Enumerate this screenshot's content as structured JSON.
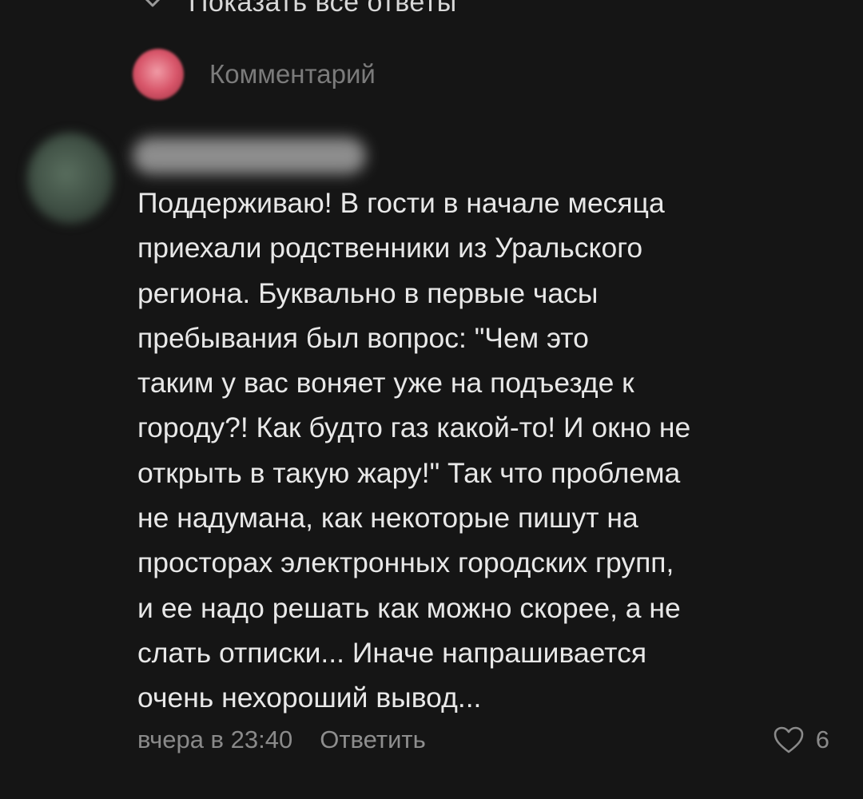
{
  "thread": {
    "show_replies_label": "Показать все ответы"
  },
  "reply_bar": {
    "placeholder": "Комментарий"
  },
  "comment": {
    "text": "Поддерживаю! В гости в начале месяца\nприехали родственники из Уральского\nрегиона. Буквально в первые часы\nпребывания был вопрос: \"Чем это\nтаким у вас воняет уже на подъезде к\nгороду?! Как будто газ какой-то! И окно не\nоткрыть в такую жару!\" Так что проблема\nне надумана, как некоторые пишут на\nпросторах электронных городских групп,\nи ее надо решать как можно скорее, а не\nслать отписки... Иначе напрашивается\nочень нехороший вывод...",
    "timestamp": "вчера в 23:40",
    "reply_label": "Ответить",
    "likes_count": "6"
  },
  "icons": {
    "show_replies": "chevron-down-icon",
    "like": "heart-icon"
  },
  "colors": {
    "background": "#151515",
    "text": "#e8e8e8",
    "muted": "#8a8a8a"
  }
}
